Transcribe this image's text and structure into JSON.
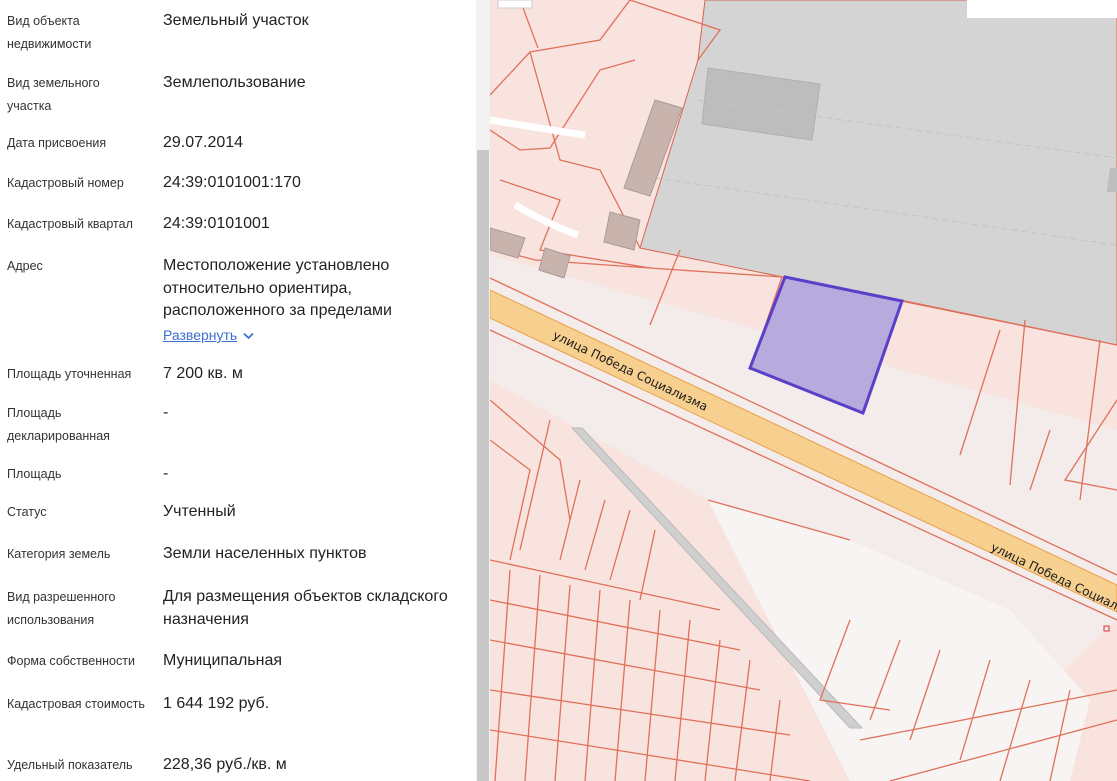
{
  "properties": [
    {
      "label": "Вид объекта недвижимости",
      "value": "Земельный участок"
    },
    {
      "label": "Вид земельного участка",
      "value": "Землепользование"
    },
    {
      "label": "Дата присвоения",
      "value": "29.07.2014"
    },
    {
      "label": "Кадастровый номер",
      "value": "24:39:0101001:170"
    },
    {
      "label": "Кадастровый квартал",
      "value": "24:39:0101001"
    },
    {
      "label": "Адрес",
      "value": "Местоположение установлено относительно ориентира, расположенного за пределами"
    },
    {
      "label": "Площадь уточненная",
      "value": "7 200 кв. м"
    },
    {
      "label": "Площадь декларированная",
      "value": "-"
    },
    {
      "label": "Площадь",
      "value": "-"
    },
    {
      "label": "Статус",
      "value": "Учтенный"
    },
    {
      "label": "Категория земель",
      "value": "Земли населенных пунктов"
    },
    {
      "label": "Вид разрешенного использования",
      "value": "Для размещения объектов складского назначения"
    },
    {
      "label": "Форма собственности",
      "value": "Муниципальная"
    },
    {
      "label": "Кадастровая стоимость",
      "value": "1 644 192 руб."
    },
    {
      "label": "Удельный показатель",
      "value": "228,36 руб./кв. м"
    }
  ],
  "address_expand": {
    "label": "Развернуть"
  },
  "map": {
    "street_label": "улица Победа Социализма",
    "colors": {
      "parcel_fill": "#f9e3df",
      "parcel_line": "#e0705a",
      "road": "#f7cf8f",
      "road_edge": "#e8a04a",
      "industrial": "#d4d4d4",
      "selected_fill": "#b3a6db",
      "selected_line": "#5a3fc9"
    }
  }
}
